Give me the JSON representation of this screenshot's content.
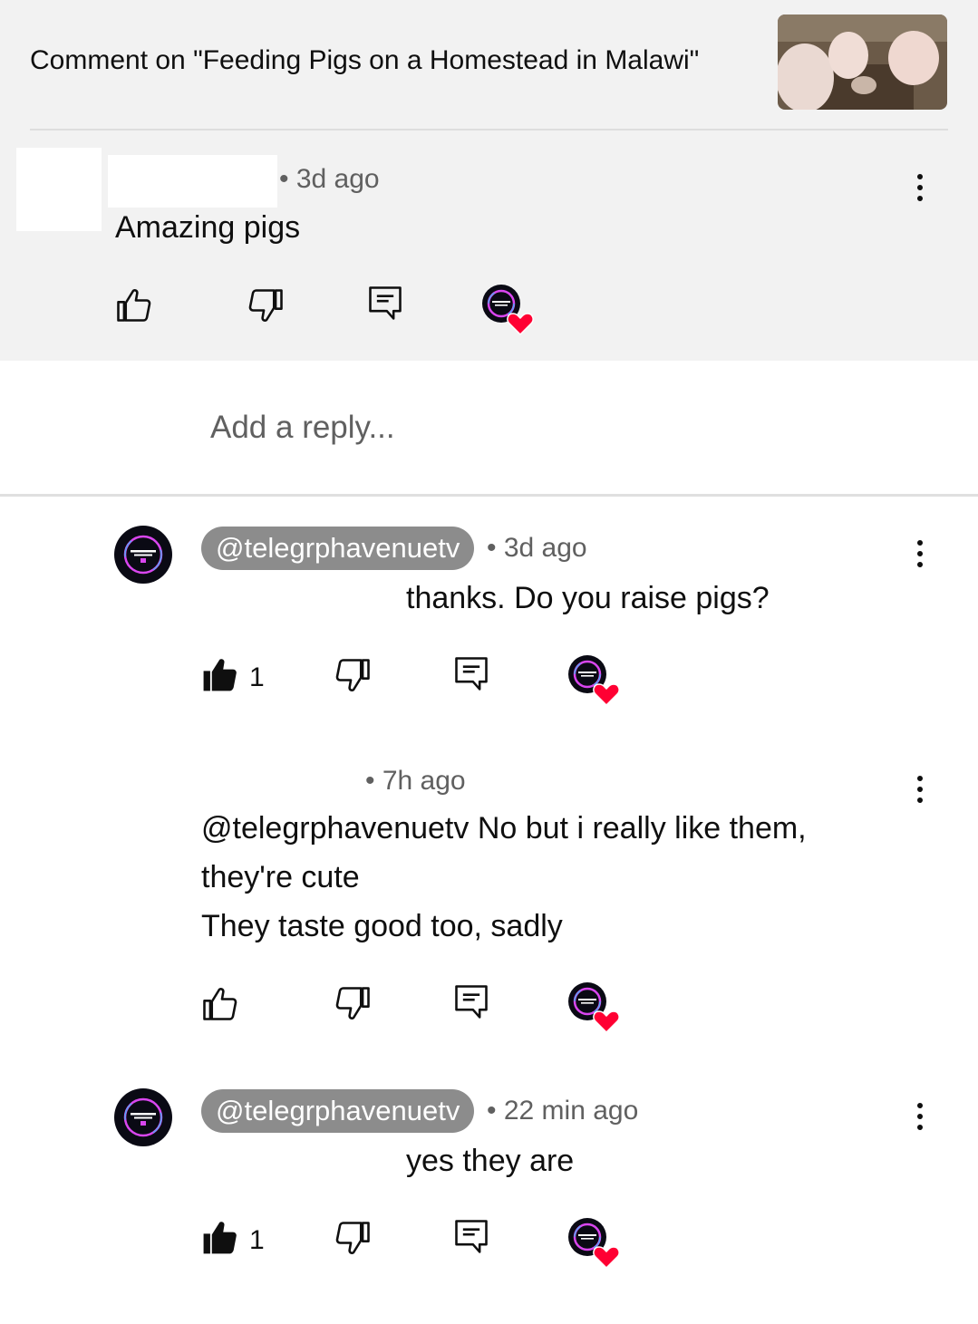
{
  "header": {
    "title": "Comment on \"Feeding Pigs on a Homestead in Malawi\""
  },
  "main_comment": {
    "time": "• 3d ago",
    "text": "Amazing pigs"
  },
  "reply_box": {
    "placeholder": "Add a reply..."
  },
  "replies": [
    {
      "handle": "@telegrphavenuetv",
      "time": "• 3d ago",
      "text": "thanks. Do you raise pigs?",
      "likes": "1"
    },
    {
      "time": "• 7h ago",
      "lines": [
        "@telegrphavenuetv  No but i really like them,",
        "they're cute",
        "They taste good too, sadly"
      ]
    },
    {
      "handle": "@telegrphavenuetv",
      "time": "• 22 min ago",
      "text": "yes they are",
      "likes": "1"
    }
  ],
  "icons": {
    "like": "thumbs-up-icon",
    "like_filled": "thumbs-up-filled-icon",
    "dislike": "thumbs-down-icon",
    "reply": "reply-comment-icon",
    "heart": "creator-heart-icon",
    "more": "more-vert-icon"
  },
  "colors": {
    "header_bg": "#f2f2f2",
    "pill_bg": "#8c8c8c",
    "heart": "#ff0033",
    "avatar_ring": "#c026d3"
  }
}
